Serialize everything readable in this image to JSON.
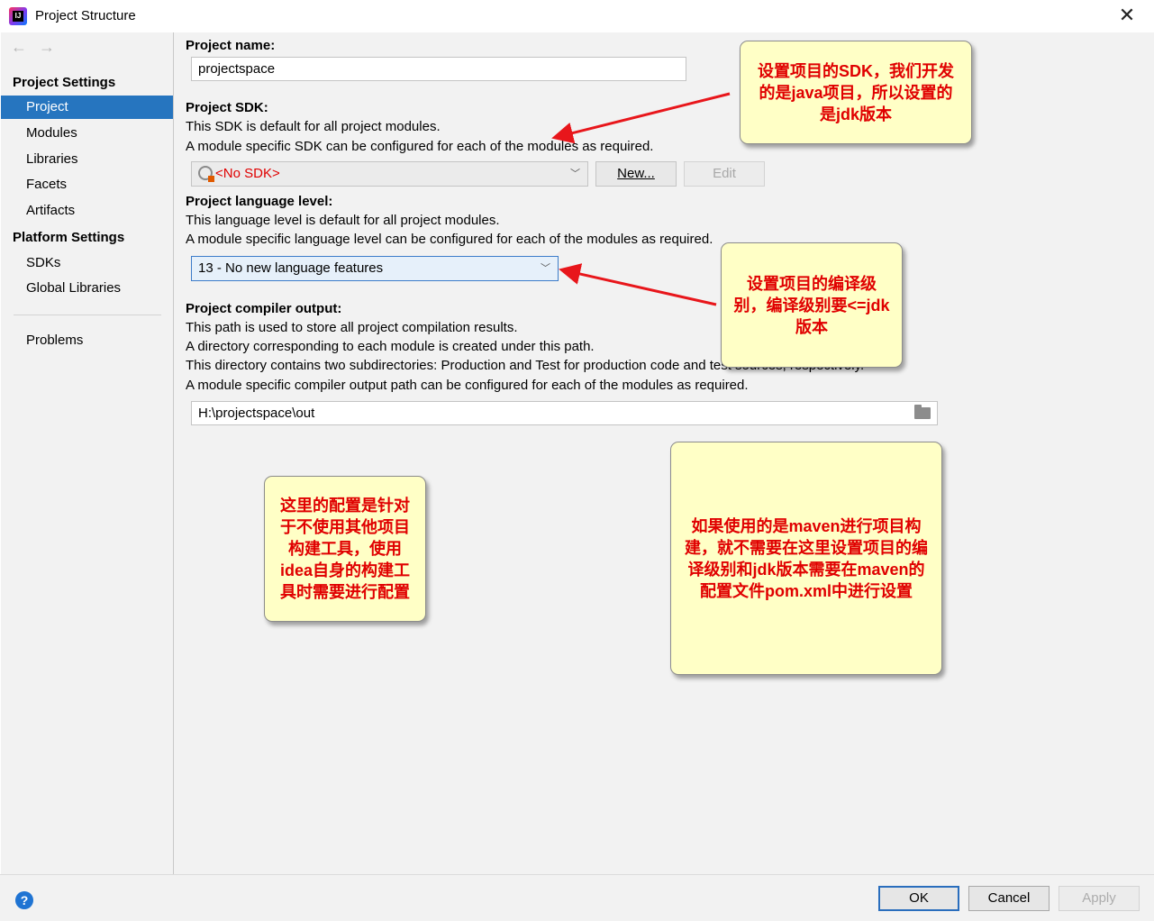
{
  "window": {
    "title": "Project Structure",
    "logo_text": "IJ"
  },
  "sidebar": {
    "back": "←",
    "forward": "→",
    "project_settings_header": "Project Settings",
    "project_settings_items": [
      {
        "label": "Project",
        "selected": true
      },
      {
        "label": "Modules"
      },
      {
        "label": "Libraries"
      },
      {
        "label": "Facets"
      },
      {
        "label": "Artifacts"
      }
    ],
    "platform_settings_header": "Platform Settings",
    "platform_settings_items": [
      {
        "label": "SDKs"
      },
      {
        "label": "Global Libraries"
      }
    ],
    "problems": "Problems"
  },
  "main": {
    "project_name": {
      "label": "Project name:",
      "value": "projectspace"
    },
    "project_sdk": {
      "label": "Project SDK:",
      "desc1": "This SDK is default for all project modules.",
      "desc2": "A module specific SDK can be configured for each of the modules as required.",
      "selected": "<No SDK>",
      "new_button": "New...",
      "edit_button": "Edit"
    },
    "language_level": {
      "label": "Project language level:",
      "desc1": "This language level is default for all project modules.",
      "desc2": "A module specific language level can be configured for each of the modules as required.",
      "selected": "13 - No new language features"
    },
    "compiler_output": {
      "label": "Project compiler output:",
      "desc1": "This path is used to store all project compilation results.",
      "desc2": "A directory corresponding to each module is created under this path.",
      "desc3": "This directory contains two subdirectories: Production and Test for production code and test sources, respectively.",
      "desc4": "A module specific compiler output path can be configured for each of the modules as required.",
      "value": "H:\\projectspace\\out"
    }
  },
  "annotations": {
    "sdk_note": "设置项目的SDK，我们开发的是java项目，所以设置的是jdk版本",
    "level_note": "设置项目的编译级别，编译级别要<=jdk版本",
    "build_note": "这里的配置是针对于不使用其他项目构建工具，使用idea自身的构建工具时需要进行配置",
    "maven_note": "如果使用的是maven进行项目构建，就不需要在这里设置项目的编译级别和jdk版本需要在maven的配置文件pom.xml中进行设置"
  },
  "footer": {
    "help": "?",
    "ok": "OK",
    "cancel": "Cancel",
    "apply": "Apply"
  },
  "colors": {
    "selection": "#2675bf",
    "note_bg": "#ffffc6",
    "note_text": "#e00000",
    "arrow": "#e8161b"
  }
}
